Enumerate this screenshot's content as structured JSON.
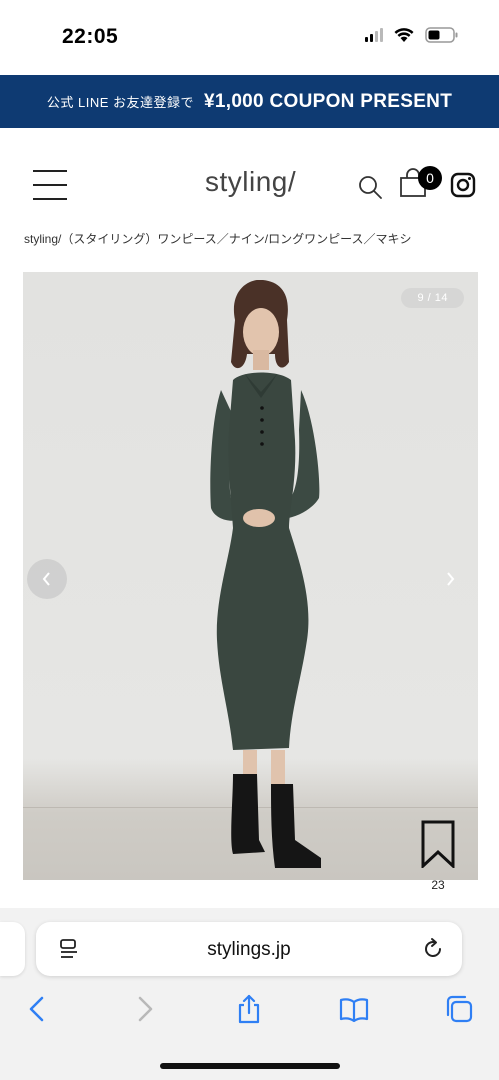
{
  "status_bar": {
    "time": "22:05",
    "icons": [
      "cellular-signal-icon",
      "wifi-icon",
      "battery-icon"
    ]
  },
  "banner": {
    "prefix": "公式 LINE お友達登録で",
    "main": "¥1,000 COUPON PRESENT",
    "background_color": "#0e3a72"
  },
  "header": {
    "logo": "styling/",
    "cart_count": "0",
    "icons": [
      "hamburger-menu-icon",
      "search-icon",
      "shopping-bag-icon",
      "instagram-icon"
    ]
  },
  "breadcrumb": "styling/（スタイリング）ワンピース／ナイン/ロングワンピース／マキシ",
  "gallery": {
    "counter": "9 / 14",
    "current": 9,
    "total": 14,
    "prev_icon": "chevron-left-icon",
    "next_icon": "chevron-right-icon"
  },
  "favorite": {
    "count": "23",
    "icon": "bookmark-icon"
  },
  "safari": {
    "url": "stylings.jp",
    "toolbar": [
      "back-icon",
      "forward-icon",
      "share-icon",
      "bookmarks-icon",
      "tabs-icon"
    ],
    "accent_color": "#2f7ff4"
  }
}
